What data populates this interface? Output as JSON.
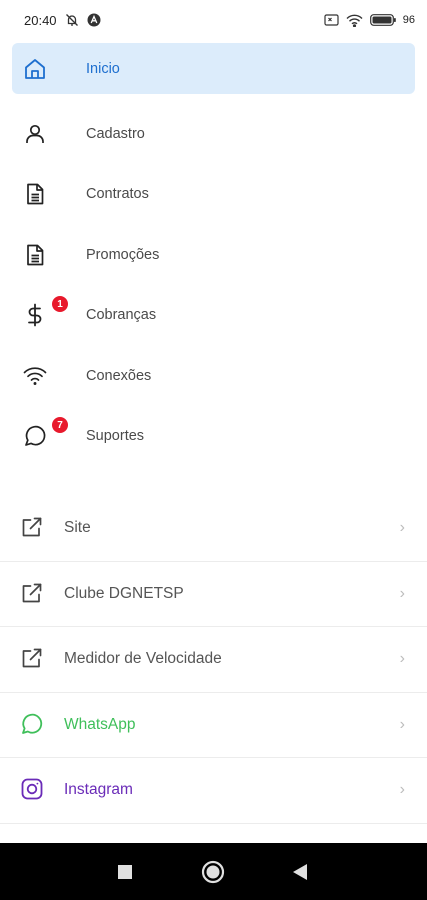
{
  "status_bar": {
    "time": "20:40",
    "battery_text": "96",
    "icons": [
      "alarm-off-icon",
      "app-notification-icon",
      "sim-icon",
      "wifi-icon",
      "battery-icon"
    ]
  },
  "menu": {
    "items": [
      {
        "label": "Inicio",
        "icon": "home-icon",
        "active": true
      },
      {
        "label": "Cadastro",
        "icon": "user-icon"
      },
      {
        "label": "Contratos",
        "icon": "document-icon"
      },
      {
        "label": "Promoções",
        "icon": "document-icon"
      },
      {
        "label": "Cobranças",
        "icon": "dollar-icon",
        "badge": "1"
      },
      {
        "label": "Conexões",
        "icon": "wifi-icon"
      },
      {
        "label": "Suportes",
        "icon": "chat-icon",
        "badge": "7"
      }
    ]
  },
  "links": {
    "items": [
      {
        "label": "Site",
        "icon": "external-link-icon"
      },
      {
        "label": "Clube DGNETSP",
        "icon": "external-link-icon"
      },
      {
        "label": "Medidor de Velocidade",
        "icon": "external-link-icon"
      },
      {
        "label": "WhatsApp",
        "icon": "whatsapp-icon"
      },
      {
        "label": "Instagram",
        "icon": "instagram-icon"
      }
    ],
    "chevron": "›"
  },
  "colors": {
    "active_bg": "#dcecfb",
    "active_text": "#1e6fcf",
    "badge": "#e8192c",
    "whatsapp": "#3fbf5a",
    "instagram": "#6a2bb8"
  },
  "nav_bar": {
    "icons": [
      "recents-square-icon",
      "home-circle-icon",
      "back-triangle-icon"
    ]
  }
}
